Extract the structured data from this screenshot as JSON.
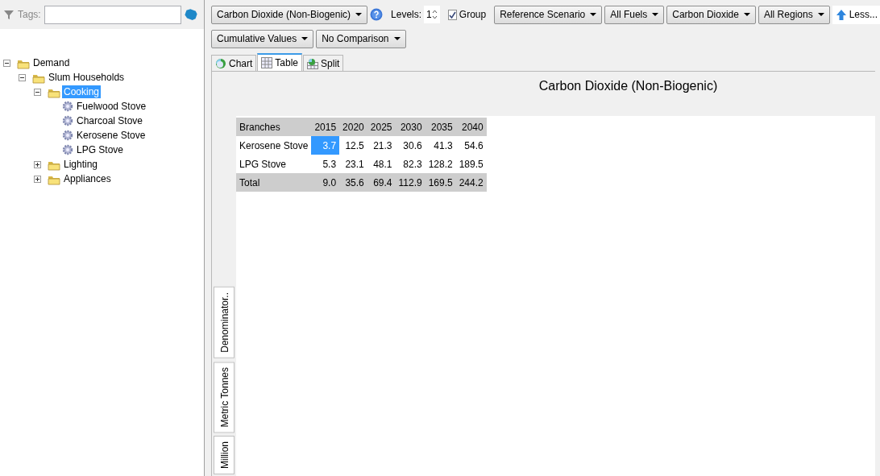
{
  "tags": {
    "label": "Tags:"
  },
  "tree": [
    {
      "label": "Demand",
      "kind": "folder",
      "expanded": true,
      "selected": false,
      "children": [
        {
          "label": "Slum Households",
          "kind": "folder",
          "expanded": true,
          "selected": false,
          "children": [
            {
              "label": "Cooking",
              "kind": "folder",
              "expanded": true,
              "selected": true,
              "children": [
                {
                  "label": "Fuelwood Stove",
                  "kind": "leaf",
                  "selected": false
                },
                {
                  "label": "Charcoal Stove",
                  "kind": "leaf",
                  "selected": false
                },
                {
                  "label": "Kerosene Stove",
                  "kind": "leaf",
                  "selected": false
                },
                {
                  "label": "LPG Stove",
                  "kind": "leaf",
                  "selected": false
                }
              ]
            },
            {
              "label": "Lighting",
              "kind": "folder",
              "expanded": false,
              "selected": false
            },
            {
              "label": "Appliances",
              "kind": "folder",
              "expanded": false,
              "selected": false
            }
          ]
        }
      ]
    }
  ],
  "toolbar_row_1": [
    {
      "kind": "dropdown",
      "label": "Carbon Dioxide (Non-Biogenic)"
    },
    {
      "kind": "help"
    },
    {
      "kind": "separator"
    },
    {
      "kind": "spinner",
      "label": "Levels:",
      "value": "1"
    },
    {
      "kind": "separator"
    },
    {
      "kind": "checkbox",
      "label": "Group",
      "checked": true
    },
    {
      "kind": "separator"
    },
    {
      "kind": "dropdown",
      "label": "Reference Scenario"
    },
    {
      "kind": "dropdown",
      "label": "All Fuels"
    },
    {
      "kind": "dropdown",
      "label": "Carbon Dioxide"
    },
    {
      "kind": "dropdown",
      "label": "All Regions"
    },
    {
      "kind": "less",
      "label": "Less..."
    }
  ],
  "toolbar_row_2": [
    {
      "kind": "dropdown",
      "label": "Cumulative Values"
    },
    {
      "kind": "dropdown",
      "label": "No Comparison"
    }
  ],
  "tabs": [
    {
      "label": "Chart",
      "kind": "chart",
      "selected": false
    },
    {
      "label": "Table",
      "kind": "table",
      "selected": true
    },
    {
      "label": "Split",
      "kind": "split",
      "selected": false
    }
  ],
  "title": "Carbon Dioxide (Non-Biogenic)",
  "side_buttons": [
    "Denominator..",
    "Metric Tonnes",
    "Million"
  ],
  "table": {
    "columns": [
      "Branches",
      "2015",
      "2020",
      "2025",
      "2030",
      "2035",
      "2040"
    ],
    "rows": [
      {
        "kind": "data",
        "cells": [
          {
            "text": "Kerosene Stove",
            "selected": false
          },
          {
            "text": "3.7",
            "selected": true
          },
          {
            "text": "12.5",
            "selected": false
          },
          {
            "text": "21.3",
            "selected": false
          },
          {
            "text": "30.6",
            "selected": false
          },
          {
            "text": "41.3",
            "selected": false
          },
          {
            "text": "54.6",
            "selected": false
          }
        ]
      },
      {
        "kind": "data",
        "cells": [
          {
            "text": "LPG Stove",
            "selected": false
          },
          {
            "text": "5.3",
            "selected": false
          },
          {
            "text": "23.1",
            "selected": false
          },
          {
            "text": "48.1",
            "selected": false
          },
          {
            "text": "82.3",
            "selected": false
          },
          {
            "text": "128.2",
            "selected": false
          },
          {
            "text": "189.5",
            "selected": false
          }
        ]
      },
      {
        "kind": "total",
        "cells": [
          {
            "text": "Total",
            "selected": false
          },
          {
            "text": "9.0",
            "selected": false
          },
          {
            "text": "35.6",
            "selected": false
          },
          {
            "text": "69.4",
            "selected": false
          },
          {
            "text": "112.9",
            "selected": false
          },
          {
            "text": "169.5",
            "selected": false
          },
          {
            "text": "244.2",
            "selected": false
          }
        ]
      }
    ]
  }
}
